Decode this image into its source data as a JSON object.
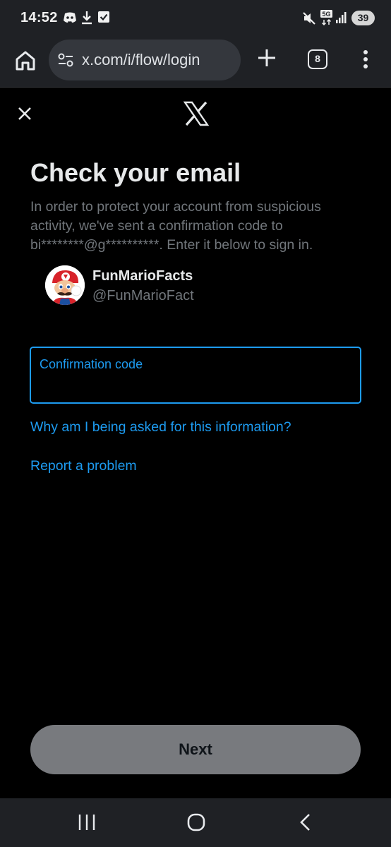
{
  "status_bar": {
    "time": "14:52",
    "battery": "39",
    "network": "5G",
    "left_icons": [
      "discord-icon",
      "download-icon",
      "check-box-icon"
    ],
    "right_icons": [
      "mute-icon",
      "5g-icon",
      "signal-icon",
      "battery-icon"
    ]
  },
  "browser": {
    "url": "x.com/i/flow/login",
    "tab_count": "8",
    "icons": [
      "home-icon",
      "site-settings-icon",
      "plus-icon",
      "tabs-icon",
      "more-vert-icon"
    ]
  },
  "page": {
    "heading": "Check your email",
    "description": "In order to protect your account from suspicious activity, we've sent a confirmation code to bi********@g**********. Enter it below to sign in.",
    "account": {
      "name": "FunMarioFacts",
      "handle": "@FunMarioFact"
    },
    "confirmation_field": {
      "label": "Confirmation code",
      "value": ""
    },
    "links": {
      "why": "Why am I being asked for this information?",
      "report": "Report a problem"
    },
    "next_label": "Next"
  },
  "colors": {
    "accent": "#1d9bf0",
    "background": "#000000",
    "muted_text": "#71767b",
    "button_disabled": "#787a7e",
    "chrome": "#1f2125"
  },
  "nav_bar": {
    "icons": [
      "recents-icon",
      "home-circle-icon",
      "back-icon"
    ]
  }
}
